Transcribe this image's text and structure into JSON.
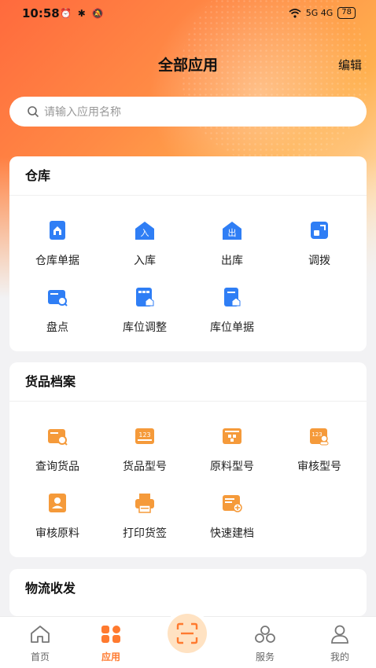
{
  "status_bar": {
    "time": "10:58",
    "left_icons": "⏰ ✱ 🔕",
    "network": "5G 4G",
    "battery": "78"
  },
  "header": {
    "title": "全部应用",
    "edit_label": "编辑"
  },
  "search": {
    "placeholder": "请输入应用名称"
  },
  "sections": [
    {
      "title": "仓库",
      "items": [
        {
          "label": "仓库单据",
          "icon": "warehouse-doc-icon"
        },
        {
          "label": "入库",
          "icon": "inbound-icon"
        },
        {
          "label": "出库",
          "icon": "outbound-icon"
        },
        {
          "label": "调拨",
          "icon": "transfer-icon"
        },
        {
          "label": "盘点",
          "icon": "inventory-check-icon"
        },
        {
          "label": "库位调整",
          "icon": "location-adjust-icon"
        },
        {
          "label": "库位单据",
          "icon": "location-doc-icon"
        }
      ]
    },
    {
      "title": "货品档案",
      "items": [
        {
          "label": "查询货品",
          "icon": "search-goods-icon"
        },
        {
          "label": "货品型号",
          "icon": "goods-model-icon"
        },
        {
          "label": "原料型号",
          "icon": "material-model-icon"
        },
        {
          "label": "审核型号",
          "icon": "review-model-icon"
        },
        {
          "label": "审核原料",
          "icon": "review-material-icon"
        },
        {
          "label": "打印货签",
          "icon": "print-label-icon"
        },
        {
          "label": "快速建档",
          "icon": "quick-create-icon"
        }
      ]
    },
    {
      "title": "物流收发",
      "items": []
    }
  ],
  "bottom_nav": [
    {
      "label": "首页",
      "icon": "home-icon",
      "active": false
    },
    {
      "label": "应用",
      "icon": "apps-icon",
      "active": true
    },
    {
      "label": "服务",
      "icon": "service-icon",
      "active": false
    },
    {
      "label": "我的",
      "icon": "profile-icon",
      "active": false
    }
  ],
  "colors": {
    "accent": "#ff7a2f",
    "blue_icon": "#2f7ef5",
    "orange_icon": "#f59a3a"
  }
}
